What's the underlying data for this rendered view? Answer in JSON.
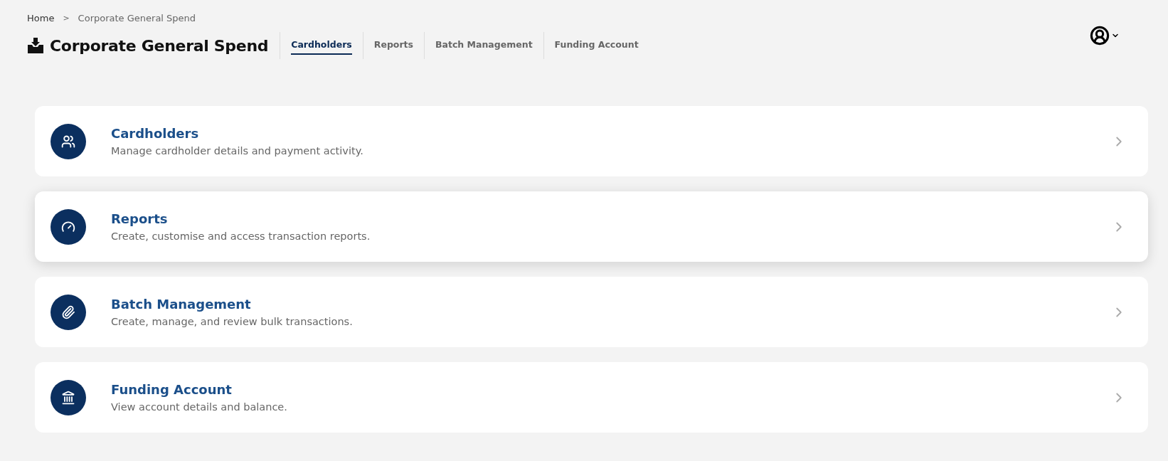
{
  "breadcrumb": [
    {
      "label": "Home"
    },
    {
      "label": "Corporate General Spend"
    }
  ],
  "breadcrumb_separator": ">",
  "page_title": "Corporate General Spend",
  "tabs": [
    {
      "label": "Cardholders",
      "selected": true
    },
    {
      "label": "Reports",
      "selected": false
    },
    {
      "label": "Batch Management",
      "selected": false
    },
    {
      "label": "Funding Account",
      "selected": false
    }
  ],
  "cards": [
    {
      "kind": "users",
      "title": "Cardholders",
      "description": "Manage cardholder details and payment activity.",
      "hovered": false
    },
    {
      "kind": "gauge",
      "title": "Reports",
      "description": "Create, customise and access transaction reports.",
      "hovered": true
    },
    {
      "kind": "paperclip",
      "title": "Batch Management",
      "description": "Create, manage, and review bulk transactions.",
      "hovered": false
    },
    {
      "kind": "bank",
      "title": "Funding Account",
      "description": "View account details and balance.",
      "hovered": false
    }
  ]
}
